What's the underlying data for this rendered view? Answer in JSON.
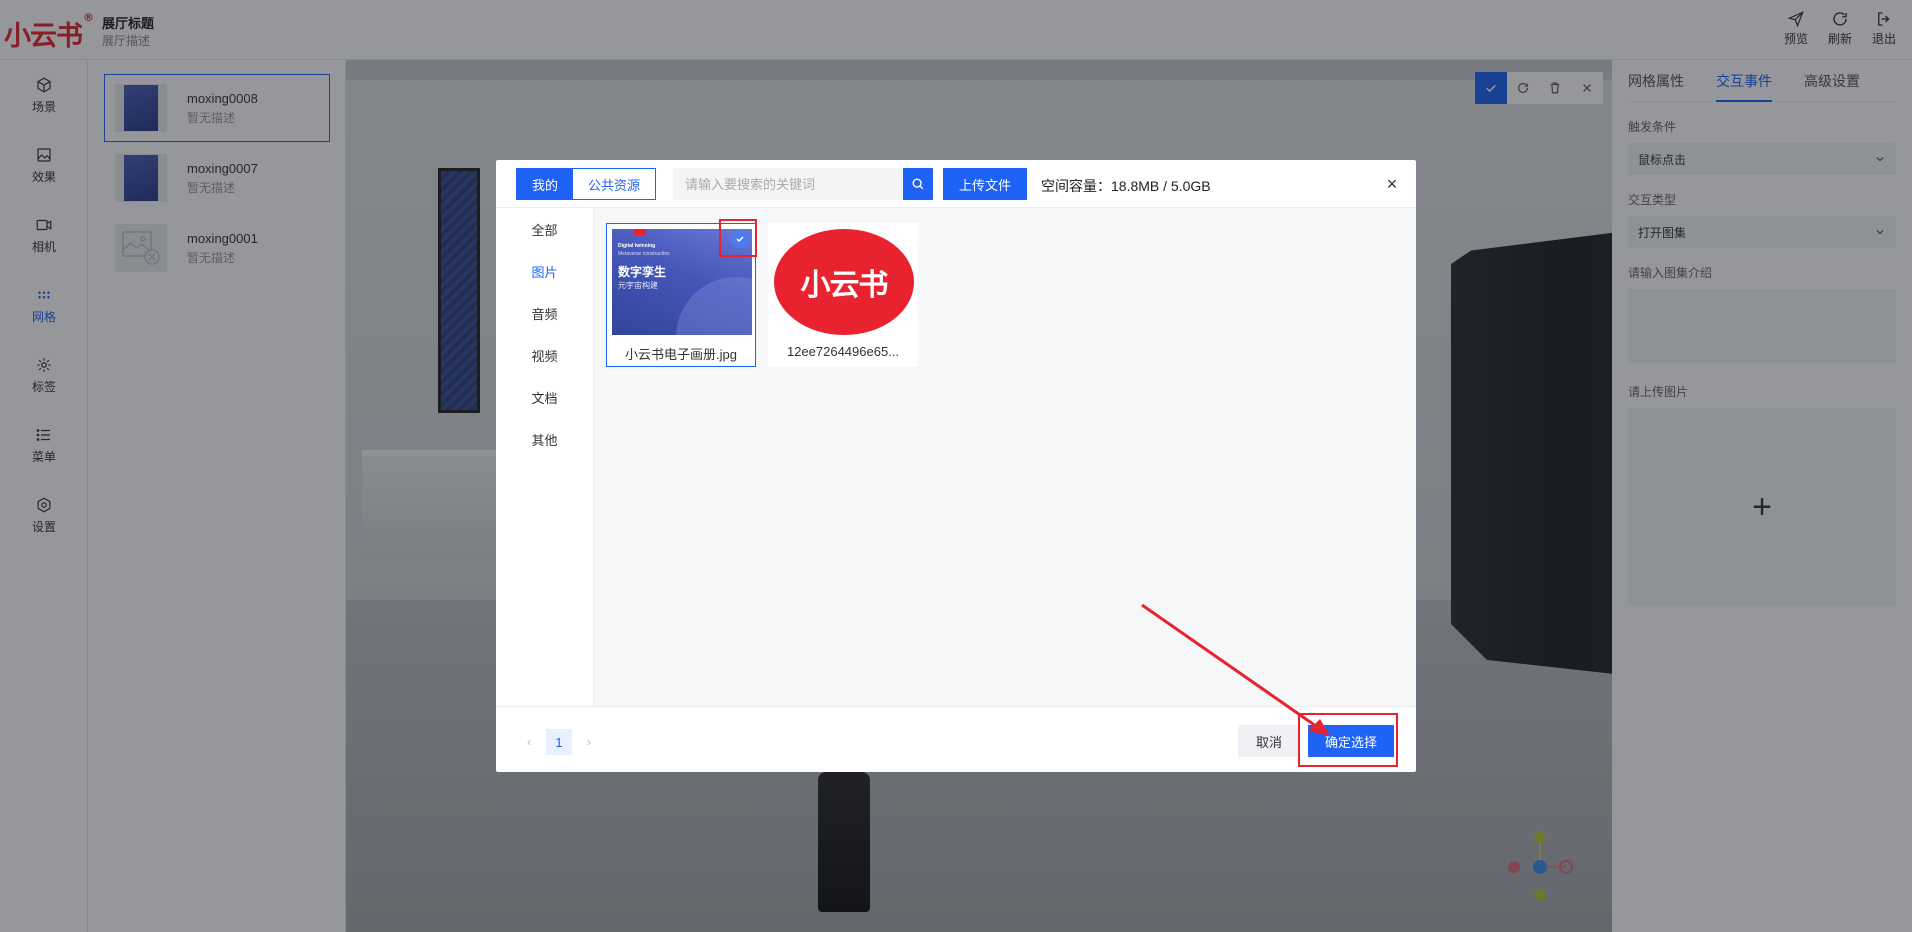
{
  "header": {
    "logo_text": "小云书",
    "logo_mark": "®",
    "title": "展厅标题",
    "description": "展厅描述",
    "actions": [
      {
        "label": "预览",
        "icon": "send-icon"
      },
      {
        "label": "刷新",
        "icon": "refresh-icon"
      },
      {
        "label": "退出",
        "icon": "logout-icon"
      }
    ]
  },
  "nav": [
    {
      "label": "场景",
      "icon": "cube-icon"
    },
    {
      "label": "效果",
      "icon": "image-effect-icon"
    },
    {
      "label": "相机",
      "icon": "camera-icon"
    },
    {
      "label": "网格",
      "icon": "grid-dots-icon",
      "active": true
    },
    {
      "label": "标签",
      "icon": "tag-icon"
    },
    {
      "label": "菜单",
      "icon": "menu-icon"
    },
    {
      "label": "设置",
      "icon": "settings-icon"
    }
  ],
  "models": [
    {
      "name": "moxing0008",
      "desc": "暂无描述",
      "selected": true
    },
    {
      "name": "moxing0007",
      "desc": "暂无描述"
    },
    {
      "name": "moxing0001",
      "desc": "暂无描述"
    }
  ],
  "right_panel": {
    "tabs": [
      "网格属性",
      "交互事件",
      "高级设置"
    ],
    "active_tab": "交互事件",
    "trigger_label": "触发条件",
    "trigger_value": "鼠标点击",
    "type_label": "交互类型",
    "type_value": "打开图集",
    "intro_label": "请输入图集介绍",
    "upload_label": "请上传图片",
    "upload_plus": "+"
  },
  "dialog": {
    "seg_mine": "我的",
    "seg_public": "公共资源",
    "search_placeholder": "请输入要搜索的关键词",
    "upload_button": "上传文件",
    "capacity": "空间容量：18.8MB / 5.0GB",
    "close": "×",
    "categories": [
      "全部",
      "图片",
      "音频",
      "视频",
      "文档",
      "其他"
    ],
    "active_category": "图片",
    "files": [
      {
        "name": "小云书电子画册.jpg",
        "selected": true,
        "cover_line1": "Digital twinning",
        "cover_line2": "Metaverse construction",
        "cover_title": "数字孪生",
        "cover_sub": "元宇宙构建"
      },
      {
        "name": "12ee7264496e65...",
        "selected": false,
        "logo_text": "小云书"
      }
    ],
    "page": "1",
    "cancel": "取消",
    "confirm": "确定选择"
  },
  "colors": {
    "primary": "#1e63f5",
    "brand_red": "#e8232f",
    "annotation_red": "#e8232f"
  }
}
